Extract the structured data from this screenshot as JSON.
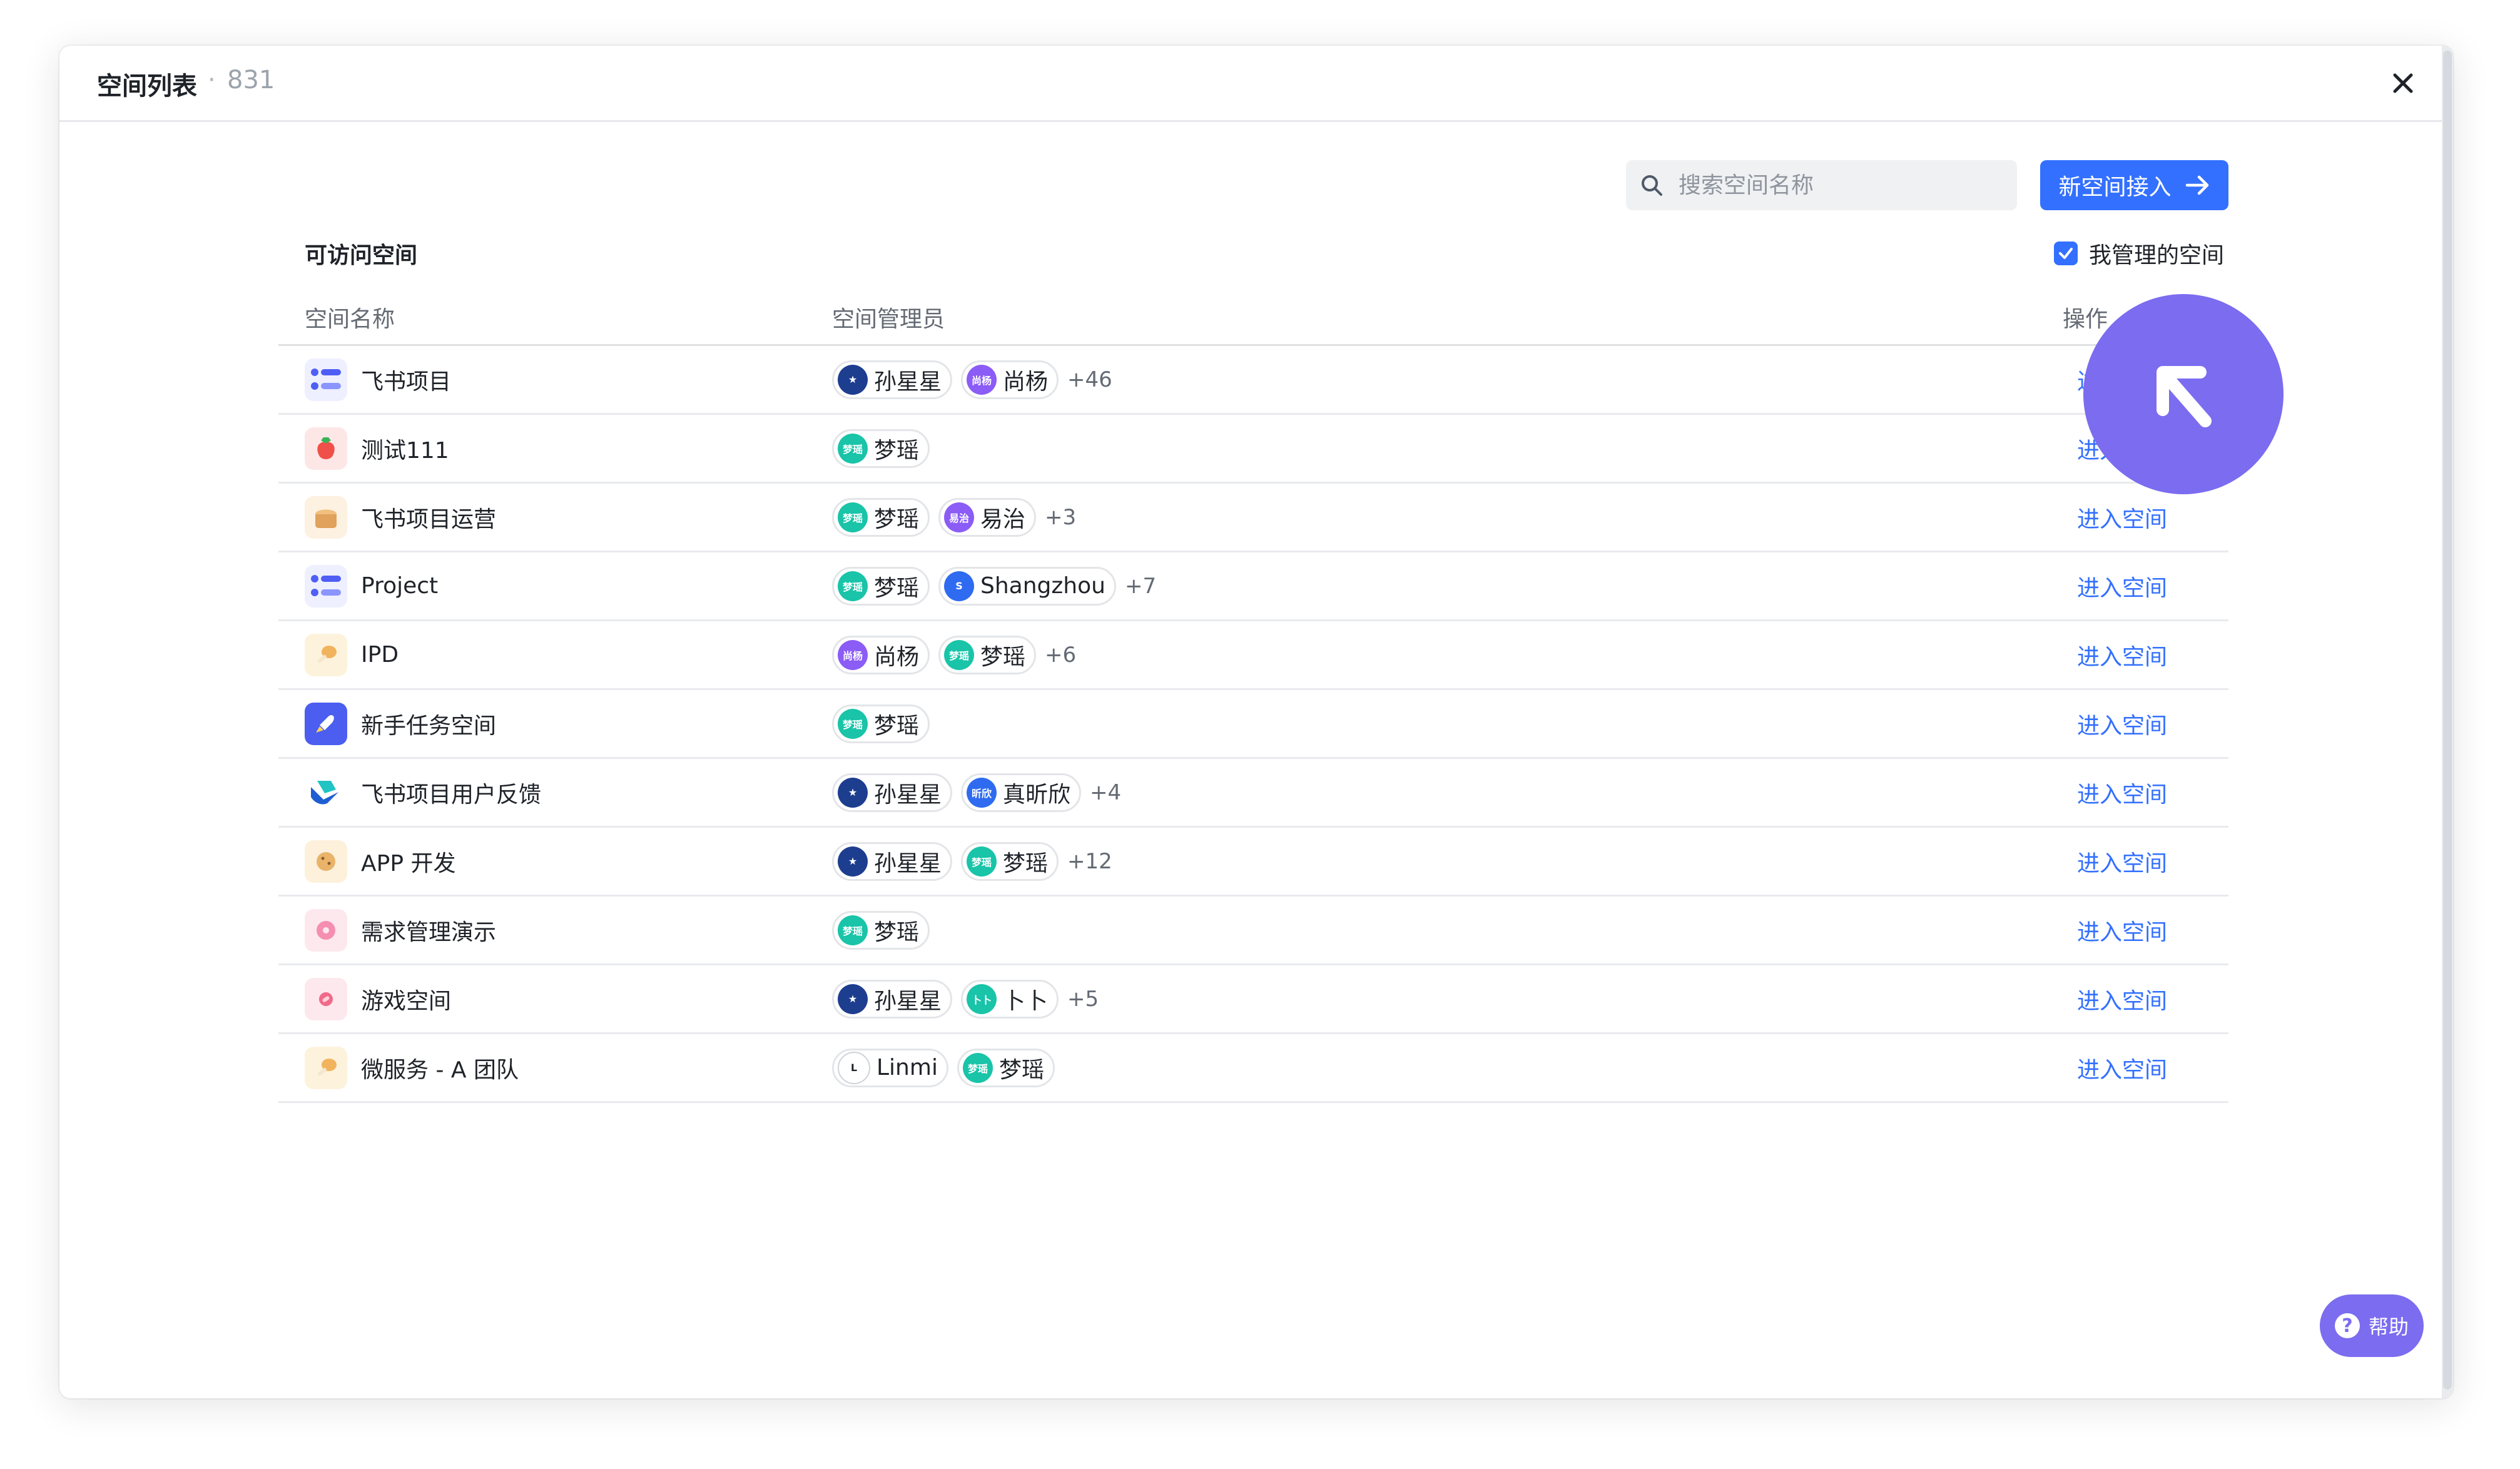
{
  "modal": {
    "title": "空间列表",
    "separator": "·",
    "count": "831"
  },
  "toolbar": {
    "search_placeholder": "搜索空间名称",
    "new_space_label": "新空间接入"
  },
  "section": {
    "title": "可访问空间"
  },
  "filter": {
    "label": "我管理的空间",
    "checked": true
  },
  "table": {
    "headers": {
      "name": "空间名称",
      "admins": "空间管理员",
      "ops": "操作"
    },
    "rows": [
      {
        "name": "飞书项目",
        "icon": "project-grid-icon",
        "admins": [
          {
            "name": "孙星星",
            "av": "★",
            "color": "#1d3d8f"
          },
          {
            "name": "尚杨",
            "av": "尚杨",
            "color": "#8b5cf6"
          }
        ],
        "more": "+46",
        "action": "进入空间"
      },
      {
        "name": "测试111",
        "icon": "strawberry-icon",
        "admins": [
          {
            "name": "梦瑶",
            "av": "梦瑶",
            "color": "#19c4a8"
          }
        ],
        "more": "",
        "action": "进入空间"
      },
      {
        "name": "飞书项目运营",
        "icon": "bread-icon",
        "admins": [
          {
            "name": "梦瑶",
            "av": "梦瑶",
            "color": "#19c4a8"
          },
          {
            "name": "易治",
            "av": "易治",
            "color": "#8b5cf6"
          }
        ],
        "more": "+3",
        "action": "进入空间"
      },
      {
        "name": "Project",
        "icon": "project-grid-icon",
        "admins": [
          {
            "name": "梦瑶",
            "av": "梦瑶",
            "color": "#19c4a8"
          },
          {
            "name": "Shangzhou",
            "av": "S",
            "color": "#2f6bf0"
          }
        ],
        "more": "+7",
        "action": "进入空间"
      },
      {
        "name": "IPD",
        "icon": "drumstick-icon",
        "admins": [
          {
            "name": "尚杨",
            "av": "尚杨",
            "color": "#8b5cf6"
          },
          {
            "name": "梦瑶",
            "av": "梦瑶",
            "color": "#19c4a8"
          }
        ],
        "more": "+6",
        "action": "进入空间"
      },
      {
        "name": "新手任务空间",
        "icon": "rocket-icon",
        "admins": [
          {
            "name": "梦瑶",
            "av": "梦瑶",
            "color": "#19c4a8"
          }
        ],
        "more": "",
        "action": "进入空间"
      },
      {
        "name": "飞书项目用户反馈",
        "icon": "feishu-logo-icon",
        "admins": [
          {
            "name": "孙星星",
            "av": "★",
            "color": "#1d3d8f"
          },
          {
            "name": "真昕欣",
            "av": "昕欣",
            "color": "#2f6bf0"
          }
        ],
        "more": "+4",
        "action": "进入空间"
      },
      {
        "name": "APP 开发",
        "icon": "cookie-icon",
        "admins": [
          {
            "name": "孙星星",
            "av": "★",
            "color": "#1d3d8f"
          },
          {
            "name": "梦瑶",
            "av": "梦瑶",
            "color": "#19c4a8"
          }
        ],
        "more": "+12",
        "action": "进入空间"
      },
      {
        "name": "需求管理演示",
        "icon": "donut-icon",
        "admins": [
          {
            "name": "梦瑶",
            "av": "梦瑶",
            "color": "#19c4a8"
          }
        ],
        "more": "",
        "action": "进入空间"
      },
      {
        "name": "游戏空间",
        "icon": "candy-icon",
        "admins": [
          {
            "name": "孙星星",
            "av": "★",
            "color": "#1d3d8f"
          },
          {
            "name": "卜卜",
            "av": "卜卜",
            "color": "#19c4a8"
          }
        ],
        "more": "+5",
        "action": "进入空间"
      },
      {
        "name": "微服务 - A 团队",
        "icon": "drumstick-icon",
        "admins": [
          {
            "name": "Linmi",
            "av": "L",
            "color": "#ffffff"
          },
          {
            "name": "梦瑶",
            "av": "梦瑶",
            "color": "#19c4a8"
          }
        ],
        "more": "",
        "action": "进入空间"
      }
    ]
  },
  "help": {
    "label": "帮助"
  },
  "icon_colors": {
    "project-grid-icon": "#eef0ff",
    "strawberry-icon": "#fde7e6",
    "bread-icon": "#fdf1e1",
    "drumstick-icon": "#fdf3dc",
    "rocket-icon": "#4b5ef0",
    "feishu-logo-icon": "#ffffff",
    "cookie-icon": "#fdf1dc",
    "donut-icon": "#fde8ee",
    "candy-icon": "#fde8ee"
  },
  "accent": "#3370ff"
}
